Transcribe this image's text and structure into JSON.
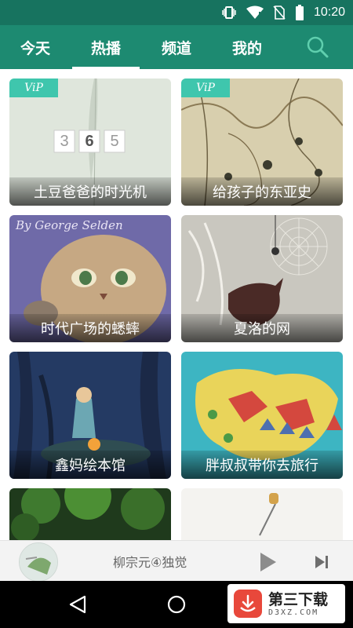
{
  "status_bar": {
    "time": "10:20"
  },
  "nav": {
    "tabs": [
      {
        "label": "今天",
        "active": false
      },
      {
        "label": "热播",
        "active": true
      },
      {
        "label": "频道",
        "active": false
      },
      {
        "label": "我的",
        "active": false
      }
    ],
    "search_icon": "search-icon"
  },
  "cards": [
    {
      "title": "土豆爸爸的时光机",
      "vip": "ViP",
      "numbers": [
        "3",
        "6",
        "5"
      ]
    },
    {
      "title": "给孩子的东亚史",
      "vip": "ViP"
    },
    {
      "title": "时代广场的蟋蟀",
      "art_text": "By George Selden"
    },
    {
      "title": "夏洛的网"
    },
    {
      "title": "鑫妈绘本馆"
    },
    {
      "title": "胖叔叔带你去旅行"
    },
    {
      "title": ""
    },
    {
      "title": ""
    }
  ],
  "player": {
    "title": "柳宗元④独觉",
    "play_icon": "play-icon",
    "next_icon": "skip-next-icon"
  },
  "system_nav": {
    "back_icon": "back-triangle-icon",
    "home_icon": "home-circle-icon"
  },
  "watermark": {
    "main": "第三下载",
    "sub": "D3XZ.COM"
  },
  "colors": {
    "header": "#1d8a71",
    "status": "#17735f",
    "vip": "#3fc6ad"
  }
}
